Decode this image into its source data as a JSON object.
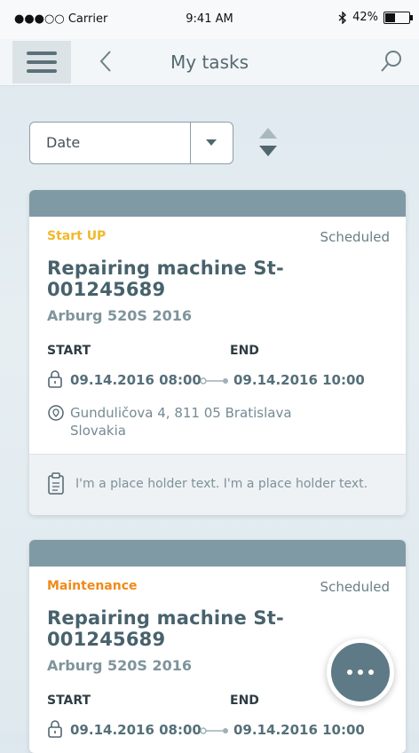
{
  "status_bar": {
    "carrier": "●●●○○ Carrier",
    "time": "9:41 AM",
    "battery": "42%"
  },
  "nav": {
    "title": "My tasks",
    "icons": [
      "menu-icon",
      "back-chevron-icon",
      "search-icon"
    ]
  },
  "sort": {
    "selected": "Date",
    "icons": [
      "chevron-down-icon",
      "sort-arrows-icon"
    ]
  },
  "tasks": [
    {
      "category": "Start UP",
      "category_color": "#f0b92a",
      "status": "Scheduled",
      "title": "Repairing machine St-001245689",
      "machine": "Arburg 520S 2016",
      "start_label": "START",
      "end_label": "END",
      "start": "09.14.2016  08:00",
      "end": "09.14.2016  10:00",
      "address_line1": "Gunduličova 4, 811 05 Bratislava",
      "address_line2": "Slovakia",
      "note": "I'm a place holder text. I'm a place holder text."
    },
    {
      "category": "Maintenance",
      "category_color": "#f08a1a",
      "status": "Scheduled",
      "title": "Repairing machine St-001245689",
      "machine": "Arburg 520S 2016",
      "start_label": "START",
      "end_label": "END",
      "start": "09.14.2016  08:00",
      "end": "09.14.2016  10:00"
    }
  ],
  "fab": {
    "icon": "more-dots-icon"
  }
}
